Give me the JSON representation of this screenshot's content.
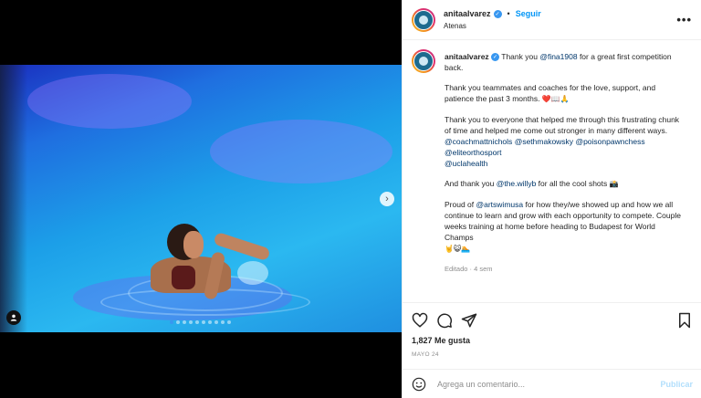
{
  "post": {
    "username": "anitaalvarez",
    "follow_label": "Seguir",
    "separator": "•",
    "location": "Atenas",
    "more_label": "•••",
    "likes": "1,827 Me gusta",
    "date": "MAYO 24",
    "edited": "Editado · 4 sem"
  },
  "caption": {
    "p1": {
      "pre": "Thank you ",
      "mention": "@fina1908",
      "post": " for a great first competition back."
    },
    "p2": {
      "text": "Thank you teammates and coaches for the love, support, and patience the past 3 months.",
      "emoji": "❤️📖🙏"
    },
    "p3": {
      "text": "Thank you to everyone that helped me through this frustrating chunk of time and helped me come out stronger in many different ways."
    },
    "mentions": [
      "@coachmattnichols",
      "@sethmakowsky",
      "@poisonpawnchess",
      "@eliteorthosport",
      "@uclahealth"
    ],
    "p4": {
      "pre": "And thank you ",
      "mention": "@the.willyb",
      "post": " for all the cool shots",
      "emoji": "📸"
    },
    "p5": {
      "pre": "Proud of ",
      "mention": "@artswimusa",
      "post": " for how they/we showed up and how we all continue to learn and grow with each opportunity to compete. Couple weeks training at home before heading to Budapest for World Champs",
      "emoji": "🤘😺🏊"
    }
  },
  "comment": {
    "placeholder": "Agrega un comentario...",
    "publish_label": "Publicar"
  },
  "carousel": {
    "next_label": "›",
    "dot_count": 10,
    "active_index": 0
  },
  "colors": {
    "accent": "#0095f6",
    "verified": "#3897f0",
    "mention": "#00376b",
    "muted": "#8e8e8e"
  },
  "icons": [
    "user-tag-icon",
    "chevron-right-icon",
    "heart-icon",
    "comment-icon",
    "share-icon",
    "bookmark-icon",
    "smile-icon",
    "verified-icon",
    "more-icon"
  ]
}
